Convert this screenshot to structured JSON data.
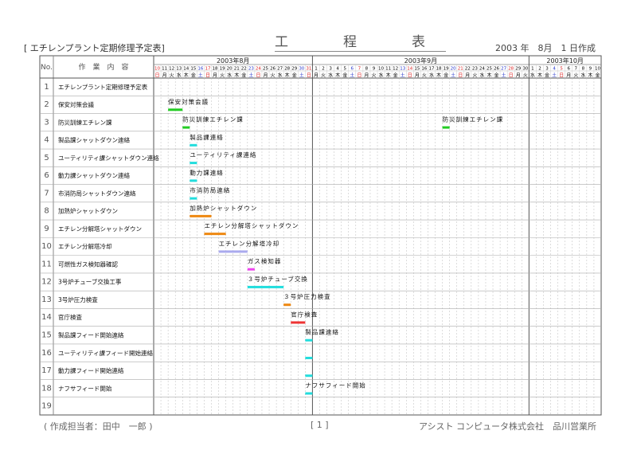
{
  "header": {
    "left_title": "[ エチレンプラント定期修理予定表]",
    "center_title": "工　程　表",
    "date": "2003 年　8月　1 日作成"
  },
  "columns": {
    "no": "No.",
    "content": "作　業　内　容"
  },
  "months": [
    {
      "label": "2003年8月",
      "start": 0,
      "count": 22
    },
    {
      "label": "2003年9月",
      "start": 22,
      "count": 30
    },
    {
      "label": "2003年10月",
      "start": 52,
      "count": 10
    }
  ],
  "days": [
    {
      "d": "10",
      "w": "日"
    },
    {
      "d": "11",
      "w": "月"
    },
    {
      "d": "12",
      "w": "火"
    },
    {
      "d": "13",
      "w": "水"
    },
    {
      "d": "14",
      "w": "木"
    },
    {
      "d": "15",
      "w": "金"
    },
    {
      "d": "16",
      "w": "土"
    },
    {
      "d": "17",
      "w": "日"
    },
    {
      "d": "18",
      "w": "月"
    },
    {
      "d": "19",
      "w": "火"
    },
    {
      "d": "20",
      "w": "水"
    },
    {
      "d": "21",
      "w": "木"
    },
    {
      "d": "22",
      "w": "金"
    },
    {
      "d": "23",
      "w": "土"
    },
    {
      "d": "24",
      "w": "日"
    },
    {
      "d": "25",
      "w": "月"
    },
    {
      "d": "26",
      "w": "火"
    },
    {
      "d": "27",
      "w": "水"
    },
    {
      "d": "28",
      "w": "木"
    },
    {
      "d": "29",
      "w": "金"
    },
    {
      "d": "30",
      "w": "土"
    },
    {
      "d": "31",
      "w": "日"
    },
    {
      "d": "1",
      "w": "月"
    },
    {
      "d": "2",
      "w": "火"
    },
    {
      "d": "3",
      "w": "水"
    },
    {
      "d": "4",
      "w": "木"
    },
    {
      "d": "5",
      "w": "金"
    },
    {
      "d": "6",
      "w": "土"
    },
    {
      "d": "7",
      "w": "日"
    },
    {
      "d": "8",
      "w": "月"
    },
    {
      "d": "9",
      "w": "火"
    },
    {
      "d": "10",
      "w": "水"
    },
    {
      "d": "11",
      "w": "木"
    },
    {
      "d": "12",
      "w": "金"
    },
    {
      "d": "13",
      "w": "土"
    },
    {
      "d": "14",
      "w": "日"
    },
    {
      "d": "15",
      "w": "月"
    },
    {
      "d": "16",
      "w": "火"
    },
    {
      "d": "17",
      "w": "水"
    },
    {
      "d": "18",
      "w": "木"
    },
    {
      "d": "19",
      "w": "金"
    },
    {
      "d": "20",
      "w": "土"
    },
    {
      "d": "21",
      "w": "日"
    },
    {
      "d": "22",
      "w": "月"
    },
    {
      "d": "23",
      "w": "火"
    },
    {
      "d": "24",
      "w": "水"
    },
    {
      "d": "25",
      "w": "木"
    },
    {
      "d": "26",
      "w": "金"
    },
    {
      "d": "27",
      "w": "土"
    },
    {
      "d": "28",
      "w": "日"
    },
    {
      "d": "29",
      "w": "月"
    },
    {
      "d": "30",
      "w": "火"
    },
    {
      "d": "1",
      "w": "水"
    },
    {
      "d": "2",
      "w": "木"
    },
    {
      "d": "3",
      "w": "金"
    },
    {
      "d": "4",
      "w": "土"
    },
    {
      "d": "5",
      "w": "日"
    },
    {
      "d": "6",
      "w": "月"
    },
    {
      "d": "7",
      "w": "火"
    },
    {
      "d": "8",
      "w": "水"
    },
    {
      "d": "9",
      "w": "木"
    },
    {
      "d": "10",
      "w": "金"
    }
  ],
  "colors": {
    "sunday": "#dd2222",
    "saturday": "#2233cc",
    "weekday": "#000000"
  },
  "tasks": [
    {
      "no": "1",
      "name": "エチレンプラント定期修理予定表",
      "bars": []
    },
    {
      "no": "2",
      "name": "保安対策会議",
      "bars": [
        {
          "start": 2,
          "end": 4,
          "color": "#22cc22",
          "label": "保安対策会議"
        }
      ]
    },
    {
      "no": "3",
      "name": "防災訓練エチレン課",
      "bars": [
        {
          "start": 4,
          "end": 5,
          "color": "#22cc22",
          "label": "防災訓練エチレン課"
        },
        {
          "start": 40,
          "end": 41,
          "color": "#22cc22",
          "label": "防災訓練エチレン課"
        }
      ]
    },
    {
      "no": "4",
      "name": "製品課シャットダウン連絡",
      "bars": [
        {
          "start": 5,
          "end": 6,
          "color": "#22dddd",
          "label": "製品課連絡"
        }
      ]
    },
    {
      "no": "5",
      "name": "ユーティリティ課シャットダウン連絡",
      "bars": [
        {
          "start": 5,
          "end": 6,
          "color": "#22dddd",
          "label": "ユーティリティ課連絡"
        }
      ]
    },
    {
      "no": "6",
      "name": "動力課シャットダウン連絡",
      "bars": [
        {
          "start": 5,
          "end": 6,
          "color": "#22dddd",
          "label": "動力課連絡"
        }
      ]
    },
    {
      "no": "7",
      "name": "市消防局シャットダウン連絡",
      "bars": [
        {
          "start": 5,
          "end": 6,
          "color": "#22dddd",
          "label": "市消防局連絡"
        }
      ]
    },
    {
      "no": "8",
      "name": "加熱炉シャットダウン",
      "bars": [
        {
          "start": 5,
          "end": 8,
          "color": "#ee8811",
          "label": "加熱炉シャットダウン"
        }
      ]
    },
    {
      "no": "9",
      "name": "エチレン分解塔シャットダウン",
      "bars": [
        {
          "start": 7,
          "end": 10,
          "color": "#ee8811",
          "label": "エチレン分解塔シャットダウン"
        }
      ]
    },
    {
      "no": "10",
      "name": "エチレン分解塔冷却",
      "bars": [
        {
          "start": 9,
          "end": 13,
          "color": "#aaaaee",
          "label": "エチレン分解塔冷却"
        }
      ]
    },
    {
      "no": "11",
      "name": "可燃性ガス検知器確認",
      "bars": [
        {
          "start": 13,
          "end": 14,
          "color": "#ee44ee",
          "label": "ガス検知器"
        }
      ]
    },
    {
      "no": "12",
      "name": "3号炉チューブ交換工事",
      "bars": [
        {
          "start": 13,
          "end": 18,
          "color": "#22dddd",
          "label": "３号炉チューブ交換"
        }
      ]
    },
    {
      "no": "13",
      "name": "3号炉圧力検査",
      "bars": [
        {
          "start": 18,
          "end": 19,
          "color": "#ee8811",
          "label": "３号炉圧力検査"
        }
      ]
    },
    {
      "no": "14",
      "name": "官庁検査",
      "bars": [
        {
          "start": 19,
          "end": 21,
          "color": "#ee3333",
          "label": "官庁検査"
        }
      ]
    },
    {
      "no": "15",
      "name": "製品課フィード開始連絡",
      "bars": [
        {
          "start": 21,
          "end": 22,
          "color": "#22dddd",
          "label": "製品課連絡"
        }
      ]
    },
    {
      "no": "16",
      "name": "ユーティリティ課フィード開始連絡",
      "bars": [
        {
          "start": 21,
          "end": 22,
          "color": "#22dddd",
          "label": ""
        }
      ]
    },
    {
      "no": "17",
      "name": "動力課フィード開始連絡",
      "bars": [
        {
          "start": 21,
          "end": 22,
          "color": "#22dddd",
          "label": ""
        }
      ]
    },
    {
      "no": "18",
      "name": "ナフサフィード開始",
      "bars": [
        {
          "start": 21,
          "end": 22,
          "color": "#22dddd",
          "label": "ナフサフィード開始"
        }
      ]
    },
    {
      "no": "19",
      "name": "",
      "bars": []
    }
  ],
  "footer": {
    "left": "( 作成担当者：田中　一郎 )",
    "center": "[ 1 ]",
    "right": "アシスト コンピュータ株式会社　品川営業所"
  }
}
